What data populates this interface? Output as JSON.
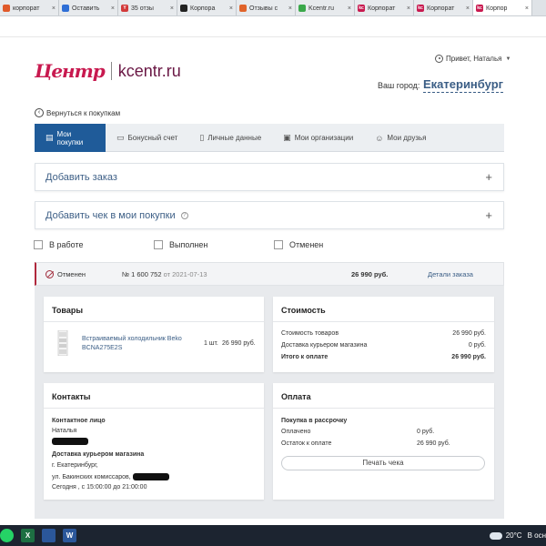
{
  "browser": {
    "tabs": [
      {
        "label": "корпорат",
        "color": "#e05a2b",
        "glyph": "",
        "active": false
      },
      {
        "label": "Оставить",
        "color": "#2f6fd6",
        "glyph": "",
        "active": false
      },
      {
        "label": "35 отзы",
        "color": "#d23a3a",
        "glyph": "Y",
        "active": false
      },
      {
        "label": "Корпора",
        "color": "#222222",
        "glyph": "",
        "active": false
      },
      {
        "label": "Отзывы с",
        "color": "#e0632a",
        "glyph": "",
        "active": false
      },
      {
        "label": "Kcentr.ru",
        "color": "#3aa84a",
        "glyph": "",
        "active": false
      },
      {
        "label": "Корпорат",
        "color": "#c8194f",
        "glyph": "kc",
        "active": false
      },
      {
        "label": "Корпорат",
        "color": "#c8194f",
        "glyph": "kc",
        "active": false
      },
      {
        "label": "Корпор",
        "color": "#c8194f",
        "glyph": "kc",
        "active": true
      }
    ]
  },
  "header": {
    "logo_script": "Центр",
    "logo_domain": "kcentr.ru",
    "greeting": "Привет, Наталья",
    "city_label": "Ваш город:",
    "city_value": "Екатеринбург"
  },
  "back_link": "Вернуться к покупкам",
  "nav": {
    "items": [
      {
        "label": "Мои покупки",
        "icon": "cart-icon",
        "glyph": "▤",
        "active": true
      },
      {
        "label": "Бонусный счет",
        "icon": "bonus-card-icon",
        "glyph": "▭",
        "active": false
      },
      {
        "label": "Личные данные",
        "icon": "document-icon",
        "glyph": "▯",
        "active": false
      },
      {
        "label": "Мои организации",
        "icon": "briefcase-icon",
        "glyph": "▣",
        "active": false
      },
      {
        "label": "Мои друзья",
        "icon": "friends-icon",
        "glyph": "☺",
        "active": false
      }
    ]
  },
  "accordions": {
    "add_order": "Добавить заказ",
    "add_receipt": "Добавить чек в мои покупки",
    "info_glyph": "?",
    "plus_glyph": "+"
  },
  "filters": [
    "В работе",
    "Выполнен",
    "Отменен"
  ],
  "order": {
    "status": "Отменен",
    "number": "№ 1 600 752",
    "date_prefix": "от",
    "date": "2021-07-13",
    "total": "26 990 руб.",
    "details_link": "Детали заказа"
  },
  "products": {
    "title": "Товары",
    "item_name_line1": "Встраиваемый холодильник Beko",
    "item_name_line2": "BCNA275E2S",
    "item_qty": "1 шт.",
    "item_price": "26 990 руб."
  },
  "cost": {
    "title": "Стоимость",
    "rows": [
      {
        "label": "Стоимость товаров",
        "value": "26 990 руб."
      },
      {
        "label": "Доставка курьером магазина",
        "value": "0 руб."
      },
      {
        "label": "Итого к оплате",
        "value": "26 990 руб."
      }
    ]
  },
  "contacts": {
    "title": "Контакты",
    "contact_label": "Контактное лицо",
    "contact_name": "Наталья",
    "delivery_label": "Доставка курьером магазина",
    "city": "г. Екатеринбург,",
    "street": "ул. Бакинских комиссаров,",
    "time": "Сегодня , с 15:00:00 до 21:00:00"
  },
  "payment": {
    "title": "Оплата",
    "method": "Покупка в рассрочку",
    "rows": [
      {
        "label": "Оплачено",
        "value": "0 руб."
      },
      {
        "label": "Остаток к оплате",
        "value": "26 990 руб."
      }
    ],
    "print_button": "Печать чека"
  },
  "taskbar": {
    "weather": "20°C",
    "weather_text": "В осн"
  }
}
